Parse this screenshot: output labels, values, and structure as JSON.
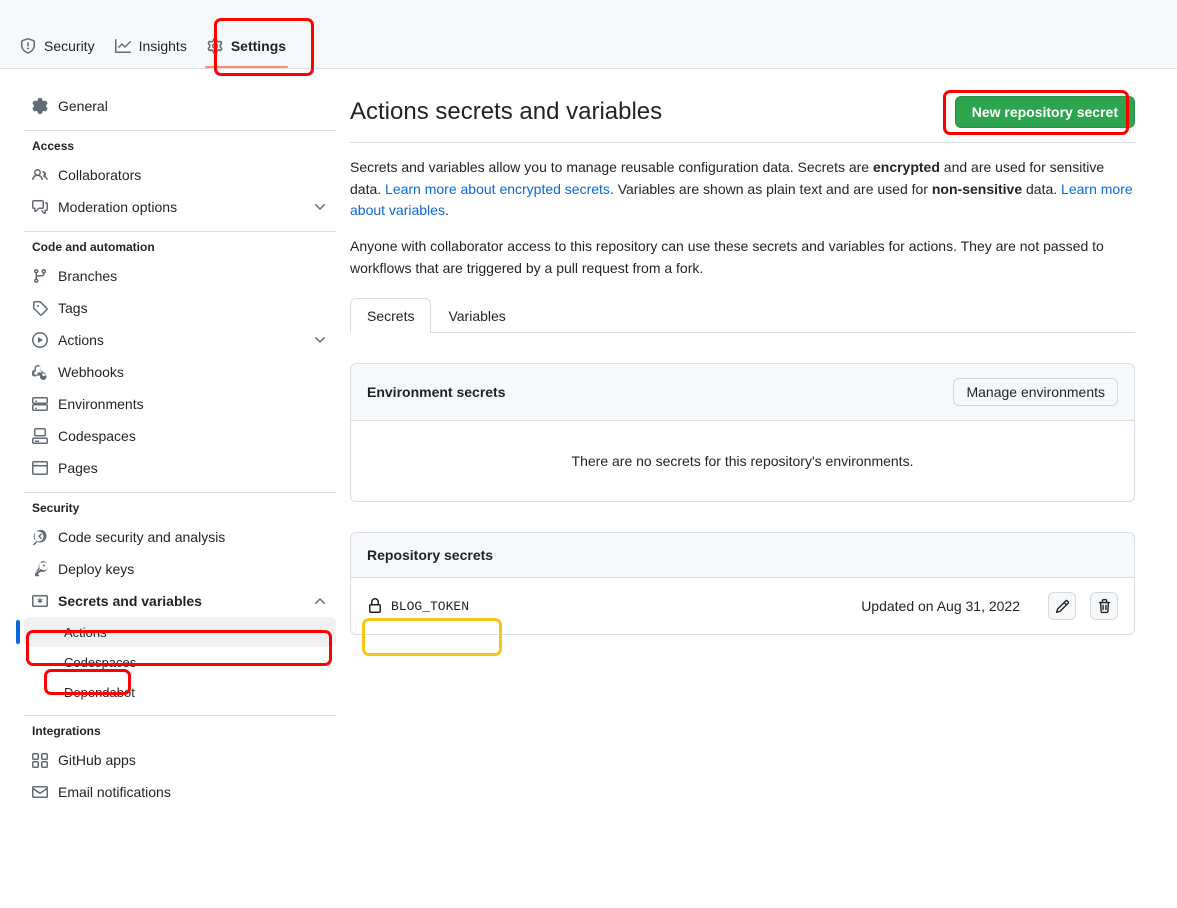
{
  "repo_nav": {
    "items": [
      {
        "label": "Security",
        "icon": "shield-icon",
        "active": false
      },
      {
        "label": "Insights",
        "icon": "graph-icon",
        "active": false
      },
      {
        "label": "Settings",
        "icon": "gear-icon",
        "active": true
      }
    ]
  },
  "sidebar": {
    "general": {
      "label": "General",
      "icon": "gear-icon"
    },
    "sections": [
      {
        "heading": "Access",
        "items": [
          {
            "label": "Collaborators",
            "icon": "people-icon",
            "chevron": false
          },
          {
            "label": "Moderation options",
            "icon": "comment-discussion-icon",
            "chevron": true
          }
        ]
      },
      {
        "heading": "Code and automation",
        "items": [
          {
            "label": "Branches",
            "icon": "git-branch-icon",
            "chevron": false
          },
          {
            "label": "Tags",
            "icon": "tag-icon",
            "chevron": false
          },
          {
            "label": "Actions",
            "icon": "play-icon",
            "chevron": true
          },
          {
            "label": "Webhooks",
            "icon": "webhook-icon",
            "chevron": false
          },
          {
            "label": "Environments",
            "icon": "server-icon",
            "chevron": false
          },
          {
            "label": "Codespaces",
            "icon": "codespaces-icon",
            "chevron": false
          },
          {
            "label": "Pages",
            "icon": "browser-icon",
            "chevron": false
          }
        ]
      },
      {
        "heading": "Security",
        "items": [
          {
            "label": "Code security and analysis",
            "icon": "codescan-icon",
            "chevron": false
          },
          {
            "label": "Deploy keys",
            "icon": "key-icon",
            "chevron": false
          },
          {
            "label": "Secrets and variables",
            "icon": "asterisk-key-icon",
            "chevron": true,
            "expanded": true,
            "highlighted": true
          }
        ],
        "subitems": [
          {
            "label": "Actions",
            "active": true,
            "highlighted": true
          },
          {
            "label": "Codespaces",
            "active": false
          },
          {
            "label": "Dependabot",
            "active": false
          }
        ]
      },
      {
        "heading": "Integrations",
        "items": [
          {
            "label": "GitHub apps",
            "icon": "apps-icon",
            "chevron": false
          },
          {
            "label": "Email notifications",
            "icon": "mail-icon",
            "chevron": false
          }
        ]
      }
    ]
  },
  "main": {
    "title": "Actions secrets and variables",
    "new_secret_button": "New repository secret",
    "paragraph1": {
      "part1": "Secrets and variables allow you to manage reusable configuration data. Secrets are ",
      "bold1": "encrypted",
      "part2": " and are used for sensitive data. ",
      "link1": "Learn more about encrypted secrets",
      "part3": ". Variables are shown as plain text and are used for ",
      "bold2": "non-sensitive",
      "part4": " data. ",
      "link2": "Learn more about variables",
      "part5": "."
    },
    "paragraph2": "Anyone with collaborator access to this repository can use these secrets and variables for actions. They are not passed to workflows that are triggered by a pull request from a fork.",
    "tabs": [
      {
        "label": "Secrets",
        "active": true
      },
      {
        "label": "Variables",
        "active": false
      }
    ],
    "environment_secrets": {
      "title": "Environment secrets",
      "manage_button": "Manage environments",
      "empty_text": "There are no secrets for this repository's environments."
    },
    "repository_secrets": {
      "title": "Repository secrets",
      "rows": [
        {
          "name": "BLOG_TOKEN",
          "updated": "Updated on Aug 31, 2022",
          "edit_icon": "pencil-icon",
          "delete_icon": "trash-icon"
        }
      ]
    }
  },
  "annotations": {
    "red_color": "#ff0000",
    "yellow_color": "#f5c518",
    "targets": [
      "settings-tab",
      "new-repository-secret-button",
      "secrets-and-variables-nav",
      "actions-subnav",
      "blog-token-secret"
    ]
  },
  "colors": {
    "accent_green": "#2da44e",
    "link_blue": "#0969da",
    "active_tab_underline": "#fd8c73",
    "surface": "#f6f8fa",
    "border": "#d8dee4"
  }
}
